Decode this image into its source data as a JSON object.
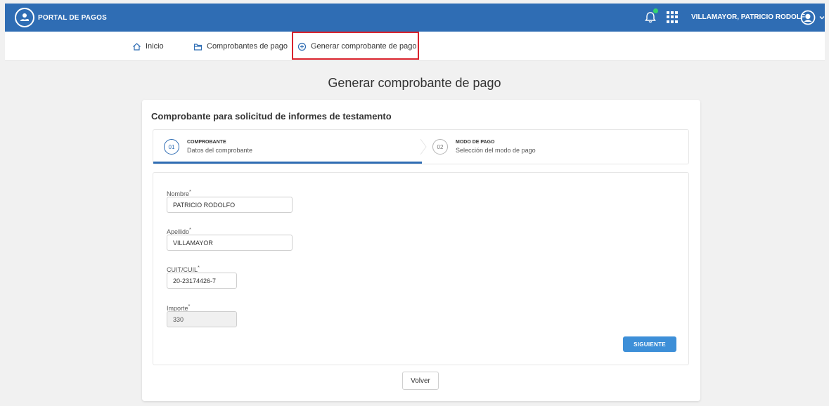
{
  "topbar": {
    "brand": "PORTAL DE PAGOS",
    "username": "VILLAMAYOR, PATRICIO RODOLFO",
    "icons": {
      "logo": "hand-coin-logo-icon",
      "notifications": "bell-icon",
      "apps": "apps-grid-icon",
      "user": "user-circle-icon",
      "menu": "chevron-down-icon"
    }
  },
  "nav": {
    "items": [
      {
        "label": "Inicio",
        "icon": "home-icon"
      },
      {
        "label": "Comprobantes de pago",
        "icon": "folder-icon"
      },
      {
        "label": "Generar comprobante de pago",
        "icon": "plus-circle-icon",
        "active": true
      }
    ]
  },
  "page": {
    "title": "Generar comprobante de pago",
    "card_title": "Comprobante para solicitud de informes de testamento"
  },
  "stepper": {
    "steps": [
      {
        "number": "01",
        "name": "COMPROBANTE",
        "description": "Datos del comprobante",
        "active": true
      },
      {
        "number": "02",
        "name": "MODO DE PAGO",
        "description": "Selección del modo de pago",
        "active": false
      }
    ]
  },
  "form": {
    "fields": [
      {
        "label": "Nombre",
        "value": "PATRICIO RODOLFO",
        "required": true
      },
      {
        "label": "Apellido",
        "value": "VILLAMAYOR",
        "required": true
      },
      {
        "label": "CUIT/CUIL",
        "value": "20-23174426-7",
        "required": true
      },
      {
        "label": "Importe",
        "value": "330",
        "required": true,
        "disabled": true
      }
    ],
    "next_label": "SIGUIENTE"
  },
  "back_label": "Volver",
  "colors": {
    "primary": "#2f6db4",
    "button": "#3d8fd8",
    "highlight": "#d9232d",
    "notification": "#34d36e"
  }
}
